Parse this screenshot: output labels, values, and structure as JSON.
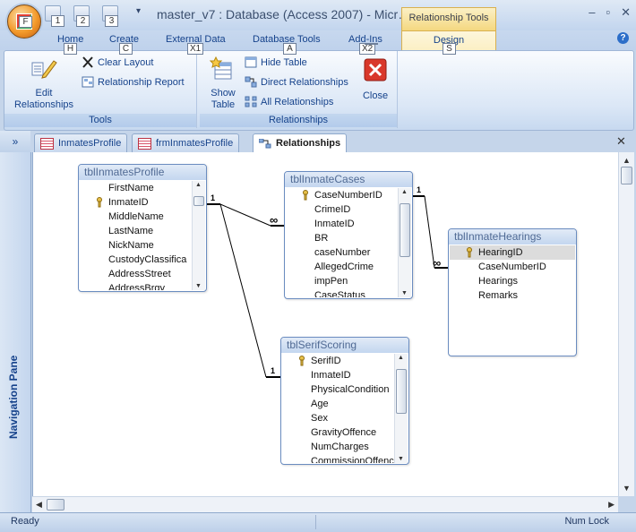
{
  "window": {
    "title": "master_v7 : Database (Access 2007) - Micr…",
    "context_header": "Relationship Tools",
    "minimize": "–",
    "restore": "▫",
    "close": "✕"
  },
  "office_button": {
    "keytip": "F"
  },
  "qat": {
    "keytips": [
      "1",
      "2",
      "3"
    ],
    "more": "▾"
  },
  "tabs": [
    {
      "label": "Home",
      "keytip": "H"
    },
    {
      "label": "Create",
      "keytip": "C"
    },
    {
      "label": "External Data",
      "keytip": "X1"
    },
    {
      "label": "Database Tools",
      "keytip": "A"
    },
    {
      "label": "Add-Ins",
      "keytip": "X2"
    },
    {
      "label": "Design",
      "keytip": "S"
    }
  ],
  "help": "?",
  "ribbon": {
    "tools": {
      "label": "Tools",
      "edit_relationships_l1": "Edit",
      "edit_relationships_l2": "Relationships",
      "clear_layout": "Clear Layout",
      "relationship_report": "Relationship Report"
    },
    "relationships": {
      "label": "Relationships",
      "show_table_l1": "Show",
      "show_table_l2": "Table",
      "hide_table": "Hide Table",
      "direct_relationships": "Direct Relationships",
      "all_relationships": "All Relationships",
      "close": "Close"
    }
  },
  "doc_tabs": {
    "toggle": "»",
    "items": [
      "InmatesProfile",
      "frmInmatesProfile",
      "Relationships"
    ],
    "close": "✕"
  },
  "nav_pane": {
    "label": "Navigation Pane"
  },
  "tables": {
    "inmates_profile": {
      "title": "tblInmatesProfile",
      "fields": [
        "FirstName",
        "InmateID",
        "MiddleName",
        "LastName",
        "NickName",
        "CustodyClassifica",
        "AddressStreet",
        "AddressBrgy"
      ]
    },
    "inmate_cases": {
      "title": "tblInmateCases",
      "fields": [
        "CaseNumberID",
        "CrimeID",
        "InmateID",
        "BR",
        "caseNumber",
        "AllegedCrime",
        "impPen",
        "CaseStatus"
      ]
    },
    "inmate_hearings": {
      "title": "tblInmateHearings",
      "fields": [
        "HearingID",
        "CaseNumberID",
        "Hearings",
        "Remarks"
      ]
    },
    "serif_scoring": {
      "title": "tblSerifScoring",
      "fields": [
        "SerifID",
        "InmateID",
        "PhysicalCondition",
        "Age",
        "Sex",
        "GravityOffence",
        "NumCharges",
        "CommissionOffence"
      ]
    }
  },
  "cardinality": {
    "one": "1",
    "many": "∞"
  },
  "status": {
    "left": "Ready",
    "right": "Num Lock"
  }
}
